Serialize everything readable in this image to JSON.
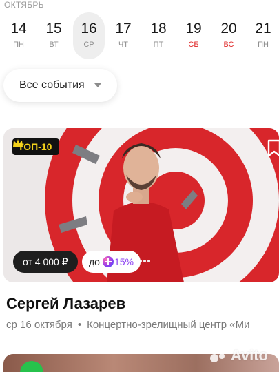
{
  "calendar": {
    "month": "ОКТЯБРЬ",
    "days": [
      {
        "num": "14",
        "weekday": "ПН",
        "weekend": false,
        "selected": false
      },
      {
        "num": "15",
        "weekday": "ВТ",
        "weekend": false,
        "selected": false
      },
      {
        "num": "16",
        "weekday": "СР",
        "weekend": false,
        "selected": true
      },
      {
        "num": "17",
        "weekday": "ЧТ",
        "weekend": false,
        "selected": false
      },
      {
        "num": "18",
        "weekday": "ПТ",
        "weekend": false,
        "selected": false
      },
      {
        "num": "19",
        "weekday": "СБ",
        "weekend": true,
        "selected": false
      },
      {
        "num": "20",
        "weekday": "ВС",
        "weekend": true,
        "selected": false
      },
      {
        "num": "21",
        "weekday": "ПН",
        "weekend": false,
        "selected": false
      }
    ]
  },
  "filter": {
    "label": "Все события",
    "icon": "chevron-down-icon"
  },
  "event": {
    "badge": "ТОП-10",
    "price": "от 4 000 ₽",
    "cashback_prefix": "до",
    "cashback_value": "15%",
    "title": "Сергей Лазарев",
    "date": "ср 16 октября",
    "separator": "•",
    "venue": "Концертно-зрелищный центр «Ми",
    "favorite_icon": "bookmark-icon"
  },
  "watermark": "Avito",
  "colors": {
    "accent_red": "#d8262b",
    "weekend": "#e02828",
    "badge_yellow": "#f4d21b",
    "plus_purple": "#8b3ef2"
  }
}
